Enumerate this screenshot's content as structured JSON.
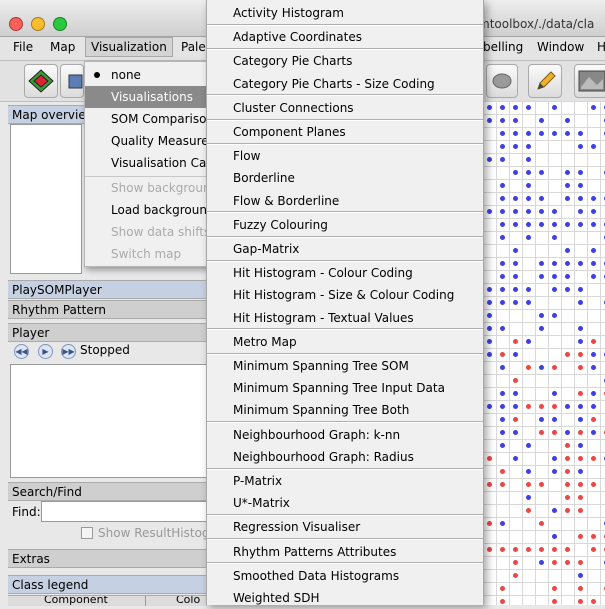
{
  "window": {
    "title": "mtoolbox/./data/cla"
  },
  "menubar": {
    "items": [
      {
        "id": "file",
        "label": "File"
      },
      {
        "id": "map",
        "label": "Map"
      },
      {
        "id": "visualization",
        "label": "Visualization"
      },
      {
        "id": "palette",
        "label": "Palet"
      },
      {
        "id": "labelling",
        "label": "belling"
      },
      {
        "id": "window",
        "label": "Window"
      },
      {
        "id": "help",
        "label": "H"
      }
    ]
  },
  "visualization_menu": {
    "items": [
      {
        "label": "none",
        "state": "checked"
      },
      {
        "label": "Visualisations",
        "state": "selected"
      },
      {
        "label": "SOM Comparison",
        "state": "enabled"
      },
      {
        "label": "Quality Measures",
        "state": "enabled"
      },
      {
        "label": "Visualisation Cac",
        "state": "enabled"
      },
      {
        "label": "Show backgroun",
        "state": "disabled"
      },
      {
        "label": "Load backgroun",
        "state": "enabled"
      },
      {
        "label": "Show data shifts",
        "state": "disabled"
      },
      {
        "label": "Switch map",
        "state": "disabled"
      }
    ]
  },
  "visualisations_submenu": {
    "groups": [
      [
        "Activity Histogram"
      ],
      [
        "Adaptive Coordinates"
      ],
      [
        "Category Pie Charts",
        "Category Pie Charts - Size Coding"
      ],
      [
        "Cluster Connections"
      ],
      [
        "Component Planes"
      ],
      [
        "Flow",
        "Borderline",
        "Flow & Borderline"
      ],
      [
        "Fuzzy Colouring"
      ],
      [
        "Gap-Matrix"
      ],
      [
        "Hit Histogram - Colour Coding",
        "Hit Histogram - Size & Colour Coding",
        "Hit Histogram - Textual Values"
      ],
      [
        "Metro Map"
      ],
      [
        "Minimum Spanning Tree SOM",
        "Minimum Spanning Tree Input Data",
        "Minimum Spanning Tree Both"
      ],
      [
        "Neighbourhood Graph: k-nn",
        "Neighbourhood Graph: Radius"
      ],
      [
        "P-Matrix",
        "U*-Matrix"
      ],
      [
        "Regression Visualiser"
      ],
      [
        "Rhythm Patterns Attributes"
      ],
      [
        "Smoothed Data Histograms",
        "Weighted SDH"
      ]
    ]
  },
  "left_panel": {
    "map_overview": "Map overview",
    "playsomplayer": "PlaySOMPlayer",
    "rhythm_pattern": "Rhythm Pattern",
    "player": "Player",
    "player_status": "Stopped",
    "search_find": "Search/Find",
    "find_label": "Find:",
    "show_result": "Show ResultHistogr",
    "extras": "Extras",
    "class_legend": "Class legend",
    "col_component": "Component",
    "col_color": "Colo"
  },
  "colors": {
    "dot_blue": "#3f3fe6",
    "dot_red": "#ee4545"
  }
}
